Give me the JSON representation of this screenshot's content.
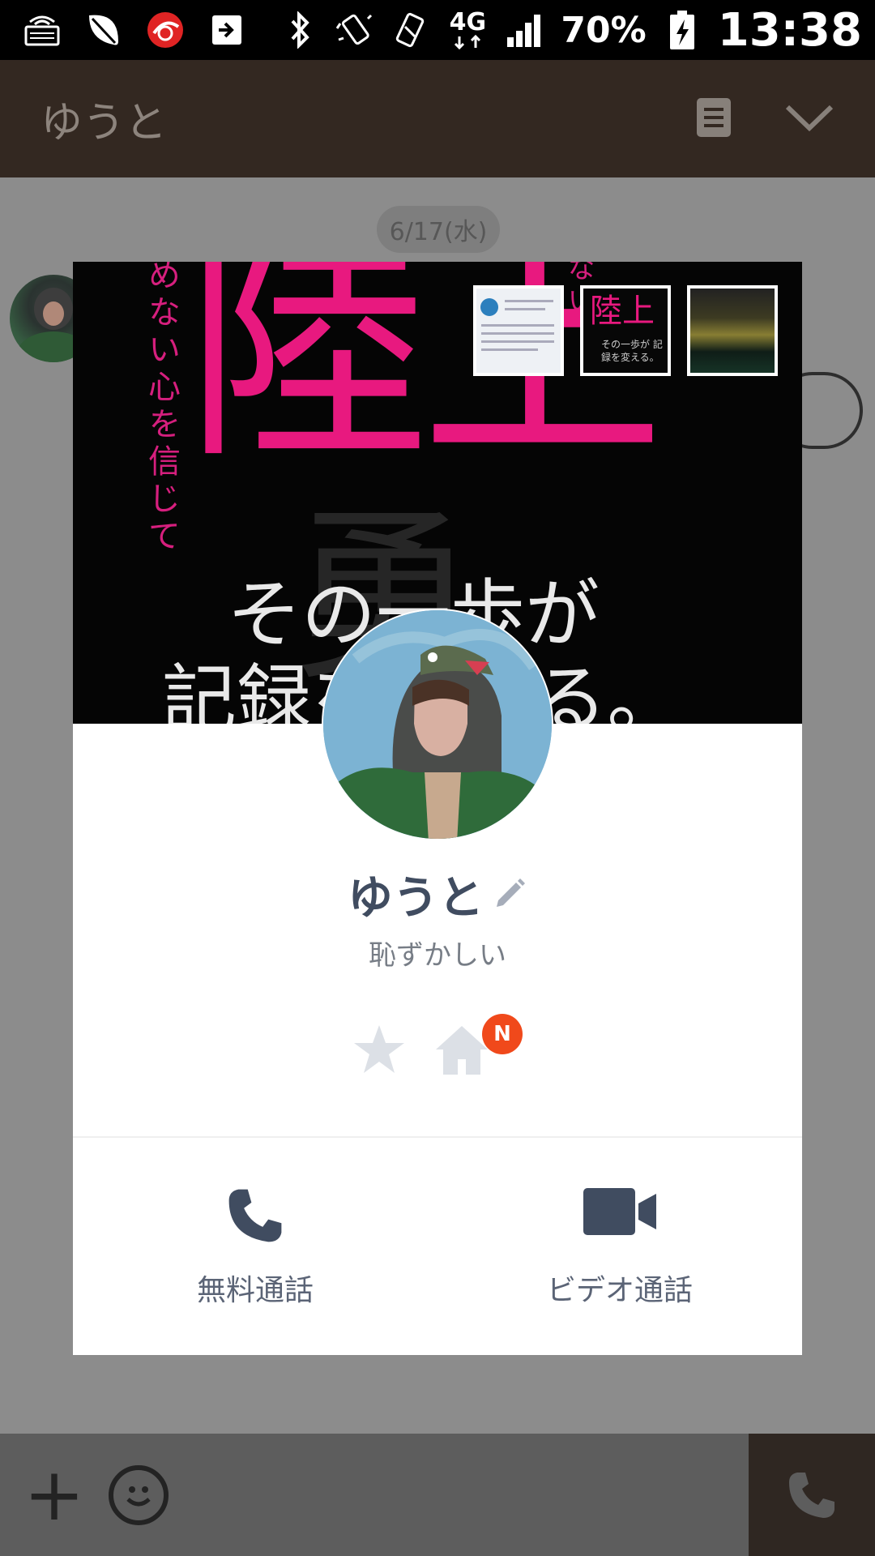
{
  "status_bar": {
    "network": "4G",
    "battery": "70%",
    "time": "13:38"
  },
  "chat": {
    "title": "ゆうと",
    "date": "6/17(水)"
  },
  "profile": {
    "cover": {
      "headline": "陸上",
      "line1": "その一歩が",
      "line2": "記録を変える。",
      "vertical_left": "めない心を信じて",
      "vertical_right": "ない"
    },
    "thumbnails": [
      {
        "name": "cover-thumb-1"
      },
      {
        "name": "cover-thumb-2",
        "big": "陸上",
        "small": "その一歩が 記録を変える。"
      },
      {
        "name": "cover-thumb-3"
      }
    ],
    "name": "ゆうと",
    "status_message": "恥ずかしい",
    "badge": "N"
  },
  "actions": {
    "free_call_label": "無料通話",
    "video_call_label": "ビデオ通話"
  },
  "colors": {
    "header_brown": "#332821",
    "overlay_gray": "#8c8c8c",
    "accent_pink": "#e8197f",
    "badge_orange": "#f0491b",
    "icon_navy": "#404c60"
  }
}
